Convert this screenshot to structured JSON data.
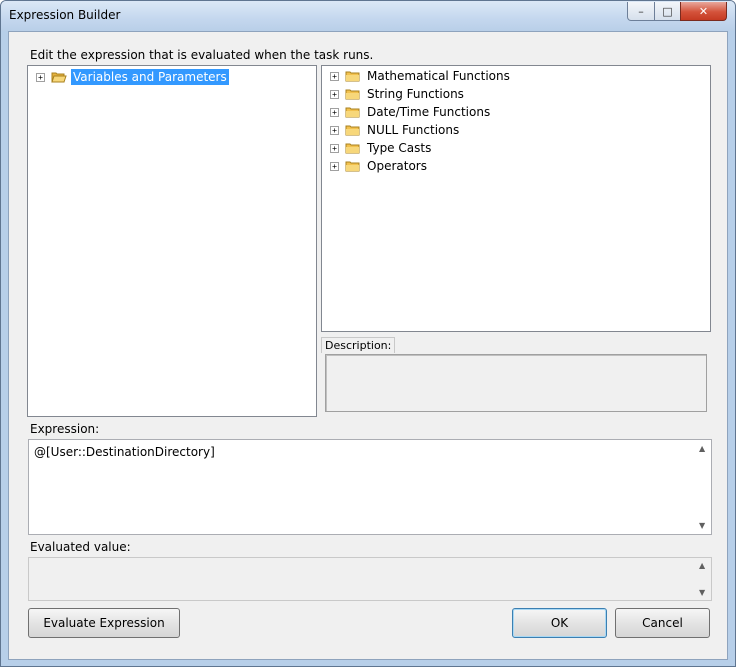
{
  "window": {
    "title": "Expression Builder"
  },
  "instructions": "Edit the expression that is evaluated when the task runs.",
  "left_tree": {
    "items": [
      {
        "label": "Variables and Parameters",
        "selected": true
      }
    ]
  },
  "right_tree": {
    "items": [
      {
        "label": "Mathematical Functions"
      },
      {
        "label": "String Functions"
      },
      {
        "label": "Date/Time Functions"
      },
      {
        "label": "NULL Functions"
      },
      {
        "label": "Type Casts"
      },
      {
        "label": "Operators"
      }
    ]
  },
  "description": {
    "label": "Description:",
    "value": ""
  },
  "expression": {
    "label": "Expression:",
    "value": "@[User::DestinationDirectory]"
  },
  "evaluated": {
    "label": "Evaluated value:",
    "value": ""
  },
  "buttons": {
    "evaluate": "Evaluate Expression",
    "ok": "OK",
    "cancel": "Cancel"
  },
  "colors": {
    "selection": "#3399ff",
    "folder": "#f2c14e",
    "close_button": "#c53a22"
  },
  "icons": {
    "folder": "folder-icon",
    "expander": "plus-box-icon"
  }
}
